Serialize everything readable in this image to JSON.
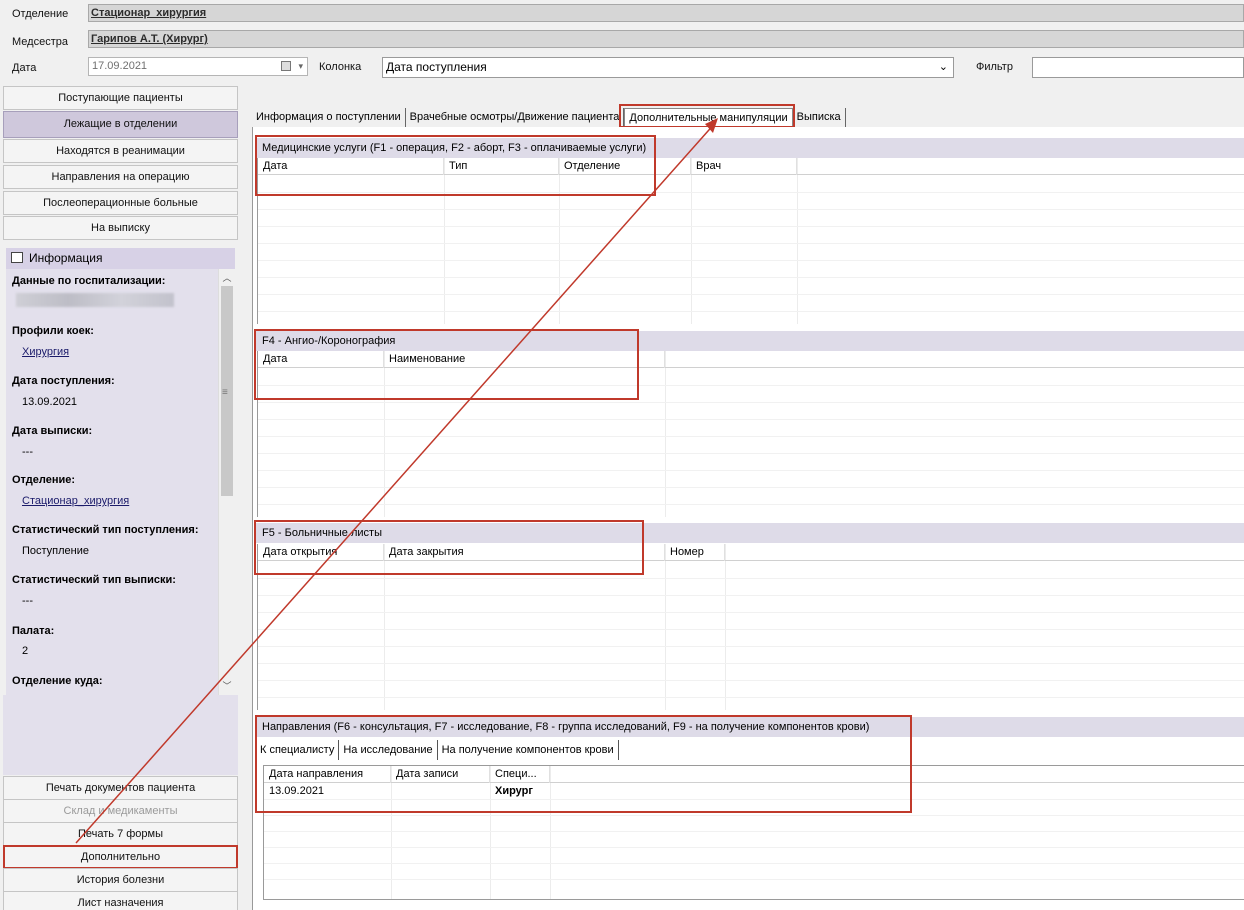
{
  "header": {
    "department_label": "Отделение",
    "department_value": "Стационар_хирургия",
    "nurse_label": "Медсестра",
    "nurse_value": "Гарипов А.Т. (Хирург)",
    "date_label": "Дата",
    "date_value": "17.09.2021",
    "column_label": "Колонка",
    "column_value": "Дата поступления",
    "filter_label": "Фильтр",
    "filter_value": ""
  },
  "left_nav": [
    "Поступающие пациенты",
    "Лежащие в отделении",
    "Находятся в реанимации",
    "Направления на операцию",
    "Послеоперационные больные",
    "На выписку"
  ],
  "info": {
    "header": "Информация",
    "fields": [
      {
        "title": "Данные по госпитализации:",
        "value": ""
      },
      {
        "title": "Профили коек:",
        "value": "Хирургия"
      },
      {
        "title": "Дата поступления:",
        "value": "13.09.2021"
      },
      {
        "title": "Дата выписки:",
        "value": "---"
      },
      {
        "title": "Отделение:",
        "value": "Стационар_хирургия"
      },
      {
        "title": "Статистический тип поступления:",
        "value": "Поступление"
      },
      {
        "title": "Статистический тип выписки:",
        "value": "---"
      },
      {
        "title": "Палата:",
        "value": "2"
      },
      {
        "title": "Отделение куда:",
        "value": ""
      }
    ]
  },
  "bottom_buttons": [
    "Печать документов пациента",
    "Склад и медикаменты",
    "Печать 7 формы",
    "Дополнительно",
    "История болезни",
    "Лист назначения"
  ],
  "tabs": [
    "Информация о поступлении",
    "Врачебные осмотры/Движение пациента",
    "Дополнительные манипуляции",
    "Выписка"
  ],
  "sections": {
    "services": {
      "title": "Медицинские услуги (F1 - операция, F2 - аборт, F3 - оплачиваемые услуги)",
      "columns": [
        "Дата",
        "Тип",
        "Отделение",
        "Врач"
      ]
    },
    "angio": {
      "title": "F4 - Ангио-/Коронография",
      "columns": [
        "Дата",
        "Наименование"
      ]
    },
    "sick": {
      "title": "F5 - Больничные листы",
      "columns": [
        "Дата открытия",
        "Дата закрытия",
        "Номер"
      ]
    },
    "referrals": {
      "title": "Направления (F6 - консультация, F7 - исследование, F8 - группа исследований, F9 - на получение компонентов крови)",
      "subtabs": [
        "К специалисту",
        "На исследование",
        "На получение компонентов крови"
      ],
      "columns": [
        "Дата направления",
        "Дата записи",
        "Специ..."
      ],
      "rows": [
        [
          "13.09.2021",
          "",
          "Хирург"
        ]
      ]
    }
  },
  "colors": {
    "annotation": "#c0392b",
    "active_nav": "#cfc8dc",
    "section_header": "#dedbe8"
  }
}
